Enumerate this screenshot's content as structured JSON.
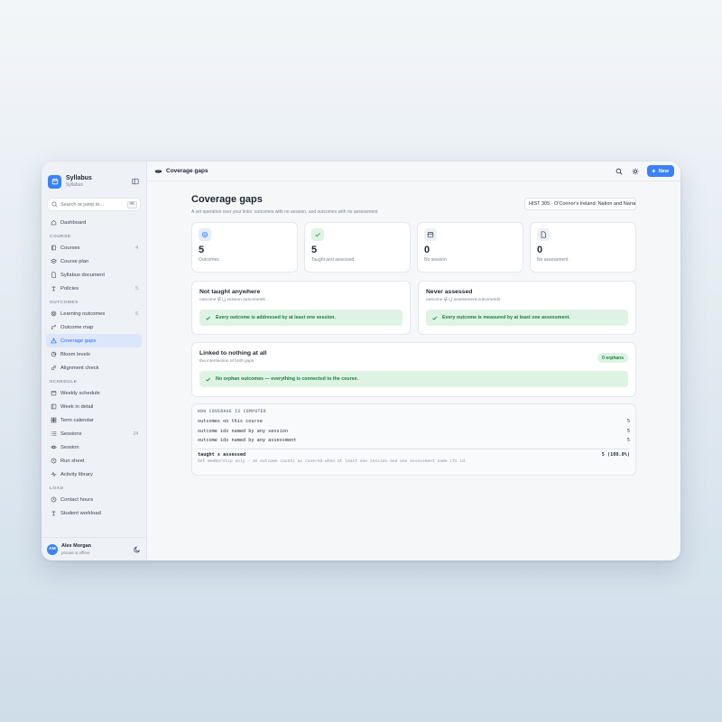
{
  "app": {
    "name": "Syllabus",
    "subtitle": "Syllabus"
  },
  "search": {
    "placeholder": "Search or jump to...",
    "shortcut": "⌘K"
  },
  "nav": {
    "dashboard": "Dashboard",
    "sections": [
      {
        "title": "COURSE",
        "items": [
          {
            "label": "Courses",
            "count": "4",
            "icon": "book-icon"
          },
          {
            "label": "Course plan",
            "count": "",
            "icon": "layers-icon"
          },
          {
            "label": "Syllabus document",
            "count": "",
            "icon": "document-icon"
          },
          {
            "label": "Policies",
            "count": "5",
            "icon": "scale-icon"
          }
        ]
      },
      {
        "title": "OUTCOMES",
        "items": [
          {
            "label": "Learning outcomes",
            "count": "5",
            "icon": "target-icon"
          },
          {
            "label": "Outcome map",
            "count": "",
            "icon": "map-icon"
          },
          {
            "label": "Coverage gaps",
            "count": "",
            "icon": "warning-icon",
            "active": true
          },
          {
            "label": "Bloom levels",
            "count": "",
            "icon": "pie-icon"
          },
          {
            "label": "Alignment check",
            "count": "",
            "icon": "link-icon"
          }
        ]
      },
      {
        "title": "SCHEDULE",
        "items": [
          {
            "label": "Weekly schedule",
            "count": "",
            "icon": "calendar-icon"
          },
          {
            "label": "Week in detail",
            "count": "",
            "icon": "columns-icon"
          },
          {
            "label": "Term calendar",
            "count": "",
            "icon": "grid-icon"
          },
          {
            "label": "Sessions",
            "count": "24",
            "icon": "list-icon"
          },
          {
            "label": "Session",
            "count": "",
            "icon": "eye-icon"
          },
          {
            "label": "Run sheet",
            "count": "",
            "icon": "clock-icon"
          },
          {
            "label": "Activity library",
            "count": "",
            "icon": "activity-icon"
          }
        ]
      },
      {
        "title": "LOAD",
        "items": [
          {
            "label": "Contact hours",
            "count": "",
            "icon": "clock-icon"
          },
          {
            "label": "Student workload",
            "count": "",
            "icon": "scale-icon"
          }
        ]
      }
    ]
  },
  "user": {
    "initials": "AM",
    "name": "Alex Morgan",
    "status": "private & offline"
  },
  "topbar": {
    "title": "Coverage gaps",
    "new_label": "New"
  },
  "page": {
    "title": "Coverage gaps",
    "subtitle": "A set operation over your links: outcomes with no session, and outcomes with no assessment",
    "course": "HIST 305 · O'Connor's Ireland: Nation and Narrative"
  },
  "stats": [
    {
      "value": "5",
      "label": "Outcomes",
      "icon": "target-icon",
      "color": "#3b82f6"
    },
    {
      "value": "5",
      "label": "Taught and assessed",
      "icon": "check-icon",
      "color": "#16a34a"
    },
    {
      "value": "0",
      "label": "No session",
      "icon": "calendar-icon",
      "color": "#6b7280"
    },
    {
      "value": "0",
      "label": "No assessment",
      "icon": "document-icon",
      "color": "#6b7280"
    }
  ],
  "cards": {
    "not_taught": {
      "title": "Not taught anywhere",
      "formula": "outcome ∉ ⋃ session.outcomeIds",
      "message": "Every outcome is addressed by at least one session."
    },
    "never_assessed": {
      "title": "Never assessed",
      "formula": "outcome ∉ ⋃ assessment.outcomeIds",
      "message": "Every outcome is measured by at least one assessment."
    },
    "orphans": {
      "title": "Linked to nothing at all",
      "subtitle": "the intersection of both gaps",
      "badge": "0 orphans",
      "message": "No orphan outcomes — everything is connected to the course."
    }
  },
  "computation": {
    "title": "HOW COVERAGE IS COMPUTED",
    "rows": [
      {
        "label": "outcomes on this course",
        "value": "5"
      },
      {
        "label": "outcome ids named by any session",
        "value": "5"
      },
      {
        "label": "outcome ids named by any assessment",
        "value": "5"
      }
    ],
    "total": {
      "label": "taught ∧ assessed",
      "value": "5 (100.0%)"
    },
    "note": "Set membership only — an outcome counts as covered when at least one session and one assessment name its id."
  },
  "colors": {
    "accent": "#3b82f6",
    "success": "#16803c",
    "success_bg": "#dff3e5"
  }
}
